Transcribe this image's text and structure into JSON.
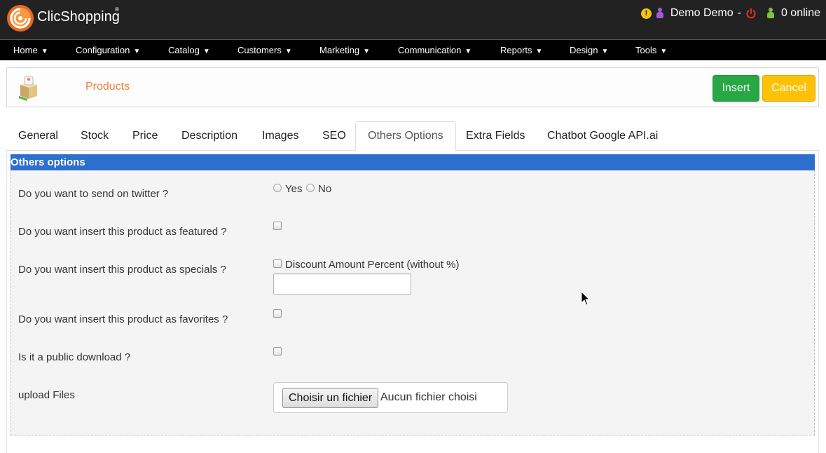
{
  "header": {
    "brand": "ClicShopping",
    "brand_mark": "®",
    "user_name": "Demo Demo",
    "separator": "-",
    "online_text": "0 online",
    "warning_glyph": "!",
    "colors": {
      "bar": "#222222",
      "warning": "#f1c40f",
      "power": "#e52b2b"
    }
  },
  "nav": {
    "items": [
      {
        "label": "Home"
      },
      {
        "label": "Configuration"
      },
      {
        "label": "Catalog"
      },
      {
        "label": "Customers"
      },
      {
        "label": "Marketing"
      },
      {
        "label": "Communication"
      },
      {
        "label": "Reports"
      },
      {
        "label": "Design"
      },
      {
        "label": "Tools"
      }
    ],
    "caret": "▼"
  },
  "page": {
    "title": "Products",
    "insert_label": "Insert",
    "cancel_label": "Cancel"
  },
  "tabs": [
    {
      "label": "General"
    },
    {
      "label": "Stock"
    },
    {
      "label": "Price"
    },
    {
      "label": "Description"
    },
    {
      "label": "Images"
    },
    {
      "label": "SEO"
    },
    {
      "label": "Others Options",
      "active": true
    },
    {
      "label": "Extra Fields"
    },
    {
      "label": "Chatbot Google API.ai"
    }
  ],
  "section": {
    "title": "Others options",
    "color": "#2c6fcc"
  },
  "form": {
    "twitter_label": "Do you want to send on twitter ?",
    "twitter_yes": "Yes",
    "twitter_no": "No",
    "featured_label": "Do you want insert this product as featured ?",
    "specials_label": "Do you want insert this product as specials ?",
    "discount_label": "Discount Amount Percent (without %)",
    "discount_value": "",
    "favorites_label": "Do you want insert this product as favorites ?",
    "download_label": "Is it a public download ?",
    "upload_label": "upload Files",
    "file_button": "Choisir un fichier",
    "file_status": "Aucun fichier choisi"
  }
}
